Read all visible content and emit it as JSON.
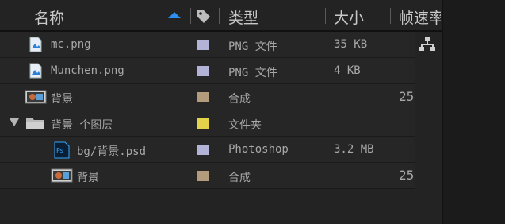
{
  "header": {
    "name_label": "名称",
    "type_label": "类型",
    "size_label": "大小",
    "framerate_label": "帧速率"
  },
  "rows": [
    {
      "name": "mc.png",
      "type": "PNG 文件",
      "size": "35 KB",
      "fr": "",
      "label_color": "#b3b3d7",
      "icon": "png-file-icon"
    },
    {
      "name": "Munchen.png",
      "type": "PNG 文件",
      "size": "4 KB",
      "fr": "",
      "label_color": "#b3b3d7",
      "icon": "png-file-icon"
    },
    {
      "name": "背景",
      "type": "合成",
      "size": "",
      "fr": "25",
      "label_color": "#b39c7c",
      "icon": "composition-icon"
    },
    {
      "name": "背景 个图层",
      "type": "文件夹",
      "size": "",
      "fr": "",
      "label_color": "#e3d24a",
      "icon": "folder-icon"
    },
    {
      "name": "bg/背景.psd",
      "type": "Photoshop",
      "size": "3.2 MB",
      "fr": "",
      "label_color": "#b3b3d7",
      "icon": "photoshop-file-icon"
    },
    {
      "name": "背景",
      "type": "合成",
      "size": "",
      "fr": "25",
      "label_color": "#b39c7c",
      "icon": "composition-icon"
    }
  ],
  "colors": {
    "accent": "#2f8ff0",
    "background": "#232323"
  }
}
